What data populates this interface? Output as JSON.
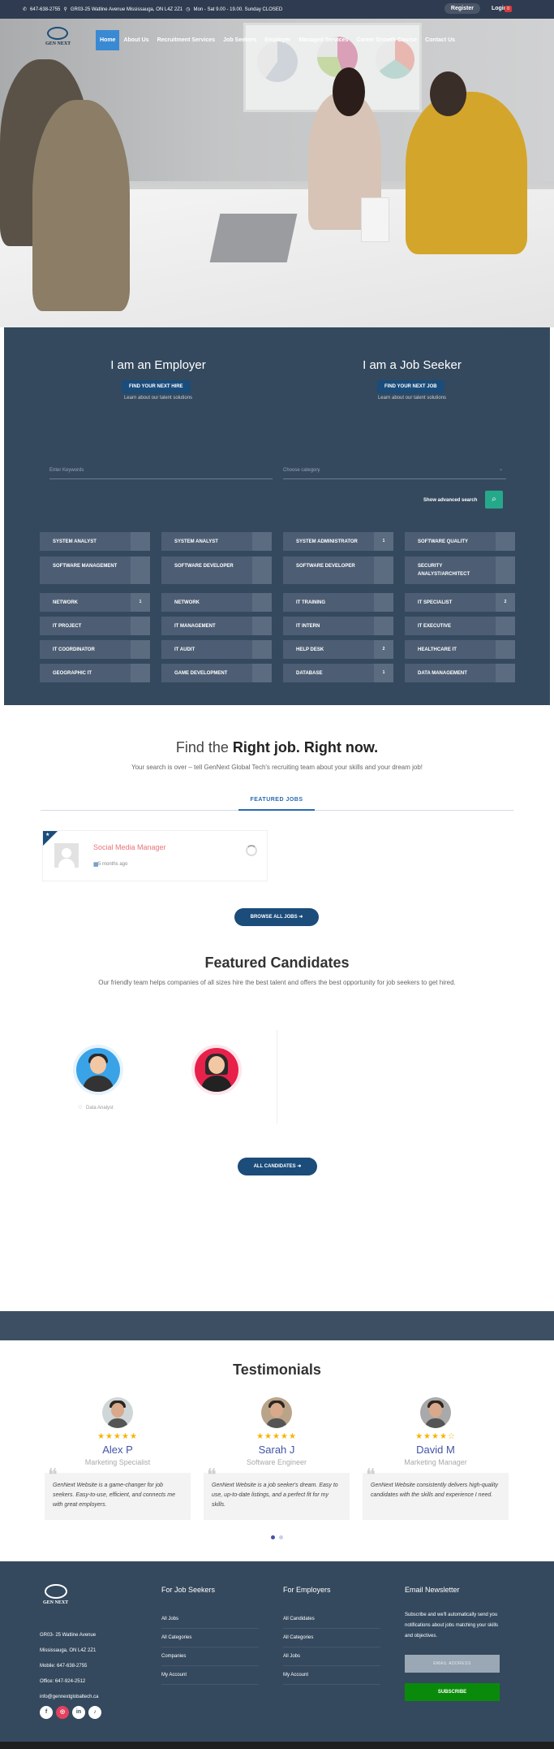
{
  "topbar": {
    "phone": "647-638-2755",
    "address": "GR03-25 Watline Avenue Mississauga, ON L4Z 2Z1",
    "hours": "Mon - Sat 9.00 - 19.00. Sunday CLOSED",
    "register": "Register",
    "login": "Login",
    "cart_count": "0"
  },
  "nav": {
    "logo_text": "GEN NEXT",
    "items": [
      "Home",
      "About Us",
      "Recruitment Services",
      "Job Seekers",
      "Employer",
      "Managed Services",
      "Career Growth Course",
      "Contact Us"
    ]
  },
  "panel": {
    "employer_title": "I am an Employer",
    "employer_btn": "FIND YOUR NEXT HIRE",
    "employer_sub": "Learn about our talent solutions",
    "seeker_title": "I am a Job Seeker",
    "seeker_btn": "FIND YOUR NEXT JOB",
    "seeker_sub": "Learn about our talent solutions",
    "keywords_placeholder": "Enter Keywords",
    "category_placeholder": "Choose category",
    "advanced": "Show advanced search",
    "categories": [
      {
        "name": "SYSTEM ANALYST",
        "count": ""
      },
      {
        "name": "SYSTEM ANALYST",
        "count": ""
      },
      {
        "name": "SYSTEM ADMINISTRATOR",
        "count": "1"
      },
      {
        "name": "SOFTWARE QUALITY",
        "count": ""
      },
      {
        "name": "SOFTWARE MANAGEMENT",
        "count": ""
      },
      {
        "name": "SOFTWARE DEVELOPER",
        "count": ""
      },
      {
        "name": "SOFTWARE DEVELOPER",
        "count": ""
      },
      {
        "name": "SECURITY ANALYST/ARCHITECT",
        "count": ""
      },
      {
        "name": "NETWORK",
        "count": "1"
      },
      {
        "name": "NETWORK",
        "count": ""
      },
      {
        "name": "IT TRAINING",
        "count": ""
      },
      {
        "name": "IT SPECIALIST",
        "count": "2"
      },
      {
        "name": "IT PROJECT",
        "count": ""
      },
      {
        "name": "IT MANAGEMENT",
        "count": ""
      },
      {
        "name": "IT INTERN",
        "count": ""
      },
      {
        "name": "IT EXECUTIVE",
        "count": ""
      },
      {
        "name": "IT COORDINATOR",
        "count": ""
      },
      {
        "name": "IT AUDIT",
        "count": ""
      },
      {
        "name": "HELP DESK",
        "count": "2"
      },
      {
        "name": "HEALTHCARE IT",
        "count": ""
      },
      {
        "name": "GEOGRAPHIC IT",
        "count": ""
      },
      {
        "name": "GAME DEVELOPMENT",
        "count": ""
      },
      {
        "name": "DATABASE",
        "count": "1"
      },
      {
        "name": "DATA MANAGEMENT",
        "count": ""
      }
    ]
  },
  "jobs": {
    "title_light": "Find the ",
    "title_bold": "Right job. Right now.",
    "subtitle": "Your search is over – tell GenNext Global Tech's recruiting team about your skills and your dream job!",
    "tab": "FEATURED JOBS",
    "job_title": "Social Media Manager",
    "job_date": "5 months ago",
    "browse_btn": "BROWSE ALL JOBS"
  },
  "candidates": {
    "title": "Featured Candidates",
    "subtitle": "Our friendly team helps companies of all sizes hire the best talent and offers the best opportunity for job seekers to get hired.",
    "candidate_role": "Data Analyst",
    "all_btn": "ALL CANDIDATES"
  },
  "testimonials": {
    "title": "Testimonials",
    "items": [
      {
        "stars": "★★★★★",
        "name": "Alex P",
        "role": "Marketing Specialist",
        "quote": "GenNext Website is a game-changer for job seekers. Easy-to-use, efficient, and connects me with great employers."
      },
      {
        "stars": "★★★★★",
        "name": "Sarah J",
        "role": "Software Engineer",
        "quote": "GenNext Website is a job seeker's dream. Easy to use, up-to-date listings, and a perfect fit for my skills."
      },
      {
        "stars": "★★★★☆",
        "name": "David M",
        "role": "Marketing Manager",
        "quote": "GenNext Website consistently delivers high-quality candidates with the skills and experience I need."
      }
    ]
  },
  "footer": {
    "logo_text": "GEN NEXT",
    "address1": "GR03- 25 Watline Avenue",
    "address2": "Mississauga, ON L4Z 2Z1",
    "mobile": "Mobile: 647-638-2755",
    "office": "Office: 647-924-2512",
    "email": "info@gennextglobaltech.ca",
    "seekers_title": "For Job Seekers",
    "seekers_links": [
      "All Jobs",
      "All Categories",
      "Companies",
      "My Account"
    ],
    "employers_title": "For Employers",
    "employers_links": [
      "All Candidates",
      "All Categories",
      "All Jobs",
      "My Account"
    ],
    "newsletter_title": "Email Newsletter",
    "newsletter_text": "Subscribe and we'll automatically send you notifications about jobs matching your skills and objectives.",
    "email_placeholder": "EMAIL ADDRESS",
    "subscribe": "SUBSCRIBE",
    "social": [
      "f",
      "◎",
      "in",
      "♪"
    ]
  }
}
